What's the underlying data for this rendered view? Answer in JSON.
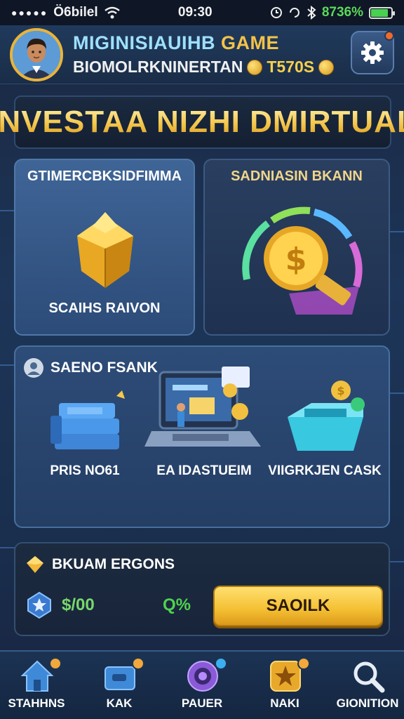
{
  "status_bar": {
    "carrier": "Ö6bilel",
    "time": "09:30",
    "battery_text": "8736%",
    "battery_level": 0.87
  },
  "header": {
    "title_part1": "MIGINISIAUIHB",
    "title_part2": "GAME",
    "subtitle": "BIOMOLRKNINERTAN",
    "points": "T570S",
    "settings_icon": "gear-icon"
  },
  "banner": {
    "text": "INVESTAA NIZHI DMIRTUAL"
  },
  "cards": [
    {
      "title": "GTIMERCBKSIDFIMMA",
      "label": "SCAIHS RAIVON",
      "icon": "gold-box-icon"
    },
    {
      "title": "SADNIASIN BKANN",
      "label": "",
      "icon": "gold-coin-icon"
    }
  ],
  "services": {
    "heading": "SAENO FSANK",
    "items": [
      {
        "label": "PRIS NO61",
        "icon": "money-stack-icon"
      },
      {
        "label": "EA IDASTUEIM",
        "icon": "laptop-icon"
      },
      {
        "label": "VIIGRKJEN CASK",
        "icon": "cash-box-icon"
      }
    ]
  },
  "bonus": {
    "heading": "BKUAM ERGONS",
    "amount": "$/00",
    "rate": "Q%",
    "button_label": "SAOILK"
  },
  "nav": [
    {
      "label": "STAHHNS",
      "icon": "home-icon"
    },
    {
      "label": "KAK",
      "icon": "wallet-icon"
    },
    {
      "label": "PAUER",
      "icon": "target-icon"
    },
    {
      "label": "NAKI",
      "icon": "star-icon"
    },
    {
      "label": "GIONITION",
      "icon": "search-icon"
    }
  ],
  "colors": {
    "gold": "#f4c64a",
    "accent_blue": "#4f78a8",
    "green": "#4fd24f"
  }
}
